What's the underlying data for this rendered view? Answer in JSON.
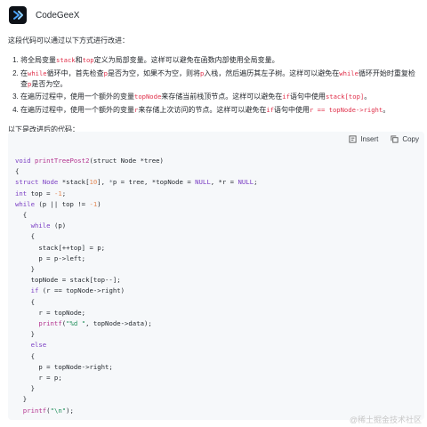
{
  "header": {
    "app_name": "CodeGeeX",
    "logo_icon": "codegeex-logo-icon"
  },
  "intro": "这段代码可以通过以下方式进行改进：",
  "items": [
    {
      "parts": [
        {
          "t": "将全局变量"
        },
        {
          "c": "stack"
        },
        {
          "t": "和"
        },
        {
          "c": "top"
        },
        {
          "t": "定义为局部变量。这样可以避免在函数内部使用全局变量。"
        }
      ]
    },
    {
      "parts": [
        {
          "t": "在"
        },
        {
          "c": "while"
        },
        {
          "t": "循环中，首先检查"
        },
        {
          "c": "p"
        },
        {
          "t": "是否为空，如果不为空，则将"
        },
        {
          "c": "p"
        },
        {
          "t": "入栈，然后遍历其左子树。这样可以避免在"
        },
        {
          "c": "while"
        },
        {
          "t": "循环开始时重复检查"
        },
        {
          "c": "p"
        },
        {
          "t": "是否为空。"
        }
      ]
    },
    {
      "parts": [
        {
          "t": "在遍历过程中，使用一个额外的变量"
        },
        {
          "c": "topNode"
        },
        {
          "t": "来存储当前栈顶节点。这样可以避免在"
        },
        {
          "c": "if"
        },
        {
          "t": "语句中使用"
        },
        {
          "c": "stack[top]"
        },
        {
          "t": "。"
        }
      ]
    },
    {
      "parts": [
        {
          "t": "在遍历过程中，使用一个额外的变量"
        },
        {
          "c": "r"
        },
        {
          "t": "来存储上次访问的节点。这样可以避免在"
        },
        {
          "c": "if"
        },
        {
          "t": "语句中使用"
        },
        {
          "c": "r == topNode->right"
        },
        {
          "t": "。"
        }
      ]
    }
  ],
  "after_text": "以下是改进后的代码：",
  "toolbar": {
    "insert_label": "Insert",
    "copy_label": "Copy"
  },
  "code_lines": [
    [
      [
        "kw",
        "void "
      ],
      [
        "fn",
        "printTreePost2"
      ],
      [
        "",
        "(struct Node *tree)"
      ]
    ],
    [
      [
        "",
        "{"
      ]
    ],
    [
      [
        "",
        ""
      ],
      [
        "ty",
        "struct Node "
      ],
      [
        "",
        "*stack["
      ],
      [
        "num",
        "10"
      ],
      [
        "",
        "], "
      ],
      [
        "cm",
        "*"
      ],
      [
        "",
        "p = tree, *topNode = "
      ],
      [
        "kw",
        "NULL"
      ],
      [
        "",
        ", *r = "
      ],
      [
        "kw",
        "NULL"
      ],
      [
        "",
        ";"
      ]
    ],
    [
      [
        "",
        ""
      ],
      [
        "kw",
        "int "
      ],
      [
        "",
        "top = "
      ],
      [
        "num",
        "-1"
      ],
      [
        "",
        ";"
      ]
    ],
    [
      [
        "",
        ""
      ],
      [
        "kw",
        "while "
      ],
      [
        "",
        "(p || top != "
      ],
      [
        "num",
        "-1"
      ],
      [
        "",
        ")"
      ]
    ],
    [
      [
        "",
        "  {"
      ]
    ],
    [
      [
        "",
        "    "
      ],
      [
        "kw",
        "while "
      ],
      [
        "",
        "(p)"
      ]
    ],
    [
      [
        "",
        "    {"
      ]
    ],
    [
      [
        "",
        "      stack[++top] = p;"
      ]
    ],
    [
      [
        "",
        "      p = p->left;"
      ]
    ],
    [
      [
        "",
        "    }"
      ]
    ],
    [
      [
        "",
        "    topNode = stack[top--];"
      ]
    ],
    [
      [
        "",
        "    "
      ],
      [
        "kw",
        "if "
      ],
      [
        "",
        "(r == topNode->right)"
      ]
    ],
    [
      [
        "",
        "    {"
      ]
    ],
    [
      [
        "",
        "      r = topNode;"
      ]
    ],
    [
      [
        "",
        "      "
      ],
      [
        "fn",
        "printf"
      ],
      [
        "",
        "("
      ],
      [
        "str",
        "\"%d \""
      ],
      [
        "",
        ", topNode->data);"
      ]
    ],
    [
      [
        "",
        "    }"
      ]
    ],
    [
      [
        "",
        "    "
      ],
      [
        "kw",
        "else"
      ]
    ],
    [
      [
        "",
        "    {"
      ]
    ],
    [
      [
        "",
        "      p = topNode->right;"
      ]
    ],
    [
      [
        "",
        "      r = p;"
      ]
    ],
    [
      [
        "",
        "    }"
      ]
    ],
    [
      [
        "",
        "  }"
      ]
    ],
    [
      [
        "",
        "  "
      ],
      [
        "fn",
        "printf"
      ],
      [
        "",
        "("
      ],
      [
        "str",
        "\"\\n\""
      ],
      [
        "",
        ");"
      ]
    ]
  ],
  "watermark": "@稀土掘金技术社区"
}
